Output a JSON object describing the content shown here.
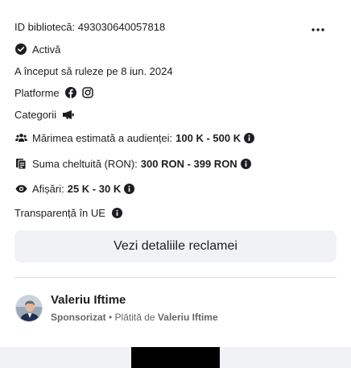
{
  "ad": {
    "library_id": "ID bibliotecă: 493030640057818",
    "status": "Activă",
    "started": "A început să ruleze pe 8 iun. 2024",
    "platforms_label": "Platforme",
    "categories_label": "Categorii",
    "audience_label": "Mărimea estimată a audienței:",
    "audience_value": "100 K - 500 K",
    "spend_label": "Suma cheltuită (RON):",
    "spend_value": "300 RON - 399 RON",
    "impressions_label": "Afișări:",
    "impressions_value": "25 K - 30 K",
    "transparency_label": "Transparență în UE",
    "details_button": "Vezi detaliile reclamei"
  },
  "advertiser": {
    "name": "Valeriu Iftime",
    "sponsored": "Sponsorizat",
    "separator": " • ",
    "paid_by_prefix": "Plătită de ",
    "paid_by_name": "Valeriu Iftime"
  },
  "icons": {
    "menu": "more-horizontal-icon",
    "status": "check-circle-icon",
    "facebook": "facebook-icon",
    "instagram": "instagram-icon",
    "category": "megaphone-icon",
    "audience": "people-icon",
    "spend": "money-icon",
    "impressions": "eye-icon",
    "info": "info-icon"
  },
  "colors": {
    "text_primary": "#1c1e21",
    "text_secondary": "#65676b",
    "button_bg": "#f0f2f5",
    "divider": "#dadde1"
  }
}
